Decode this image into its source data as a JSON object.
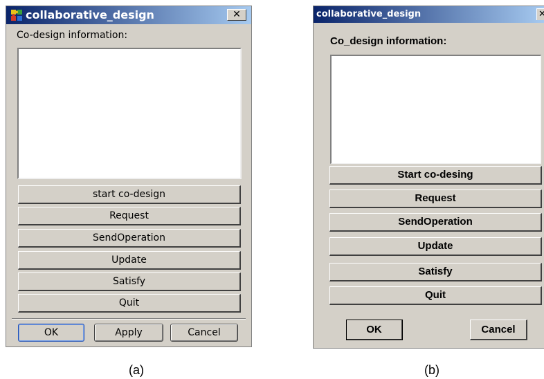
{
  "dialog_a": {
    "title": "collaborative_design",
    "close_glyph": "✕",
    "info_label": "Co-design information:",
    "info_text": "",
    "buttons": [
      "start co-design",
      "Request",
      "SendOperation",
      "Update",
      "Satisfy",
      "Quit"
    ],
    "footer": {
      "ok": "OK",
      "apply": "Apply",
      "cancel": "Cancel"
    },
    "app_icon": "puzzle-icon",
    "caption": "(a)"
  },
  "dialog_b": {
    "title": "collaborative_design",
    "close_glyph": "✕",
    "info_label": "Co_design information:",
    "info_text": "",
    "buttons": [
      "Start co-desing",
      "Request",
      "SendOperation",
      "Update",
      "Satisfy",
      "Quit"
    ],
    "footer": {
      "ok": "OK",
      "cancel": "Cancel"
    },
    "caption": "(b)"
  },
  "colors": {
    "titlebar_start": "#0a246a",
    "titlebar_end": "#a6caf0",
    "dialog_face": "#d4d0c8"
  }
}
